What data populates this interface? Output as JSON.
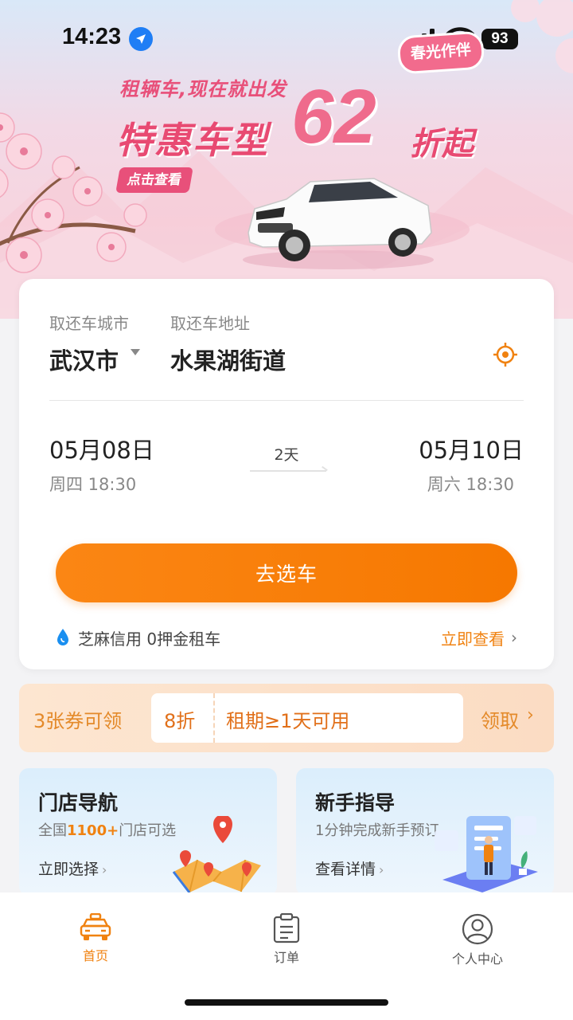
{
  "status_bar": {
    "time": "14:23",
    "battery": "93"
  },
  "banner": {
    "tag": "春光作伴",
    "subtitle": "租辆车,现在就出发",
    "headline": "特惠车型",
    "discount_number": "62",
    "discount_suffix": "折起",
    "cta": "点击查看"
  },
  "booking": {
    "city_label": "取还车城市",
    "address_label": "取还车地址",
    "city": "武汉市",
    "address": "水果湖街道",
    "pickup_date": "05月08日",
    "pickup_time": "周四 18:30",
    "duration": "2天",
    "return_date": "05月10日",
    "return_time": "周六 18:30",
    "select_car_button": "去选车",
    "credit_text": "芝麻信用 0押金租车",
    "credit_link": "立即查看"
  },
  "coupon": {
    "count_text": "3张券可领",
    "discount": "8折",
    "condition": "租期≥1天可用",
    "claim": "领取"
  },
  "features": {
    "store_nav": {
      "title": "门店导航",
      "sub_prefix": "全国",
      "sub_highlight": "1100+",
      "sub_suffix": "门店可选",
      "link": "立即选择"
    },
    "guide": {
      "title": "新手指导",
      "sub": "1分钟完成新手预订",
      "link": "查看详情"
    }
  },
  "tabbar": {
    "home": "首页",
    "orders": "订单",
    "profile": "个人中心"
  },
  "colors": {
    "accent_orange": "#f67800",
    "banner_pink": "#e84a72",
    "coupon_bg": "#fde6d1",
    "feature_bg": "#dbeefc"
  }
}
